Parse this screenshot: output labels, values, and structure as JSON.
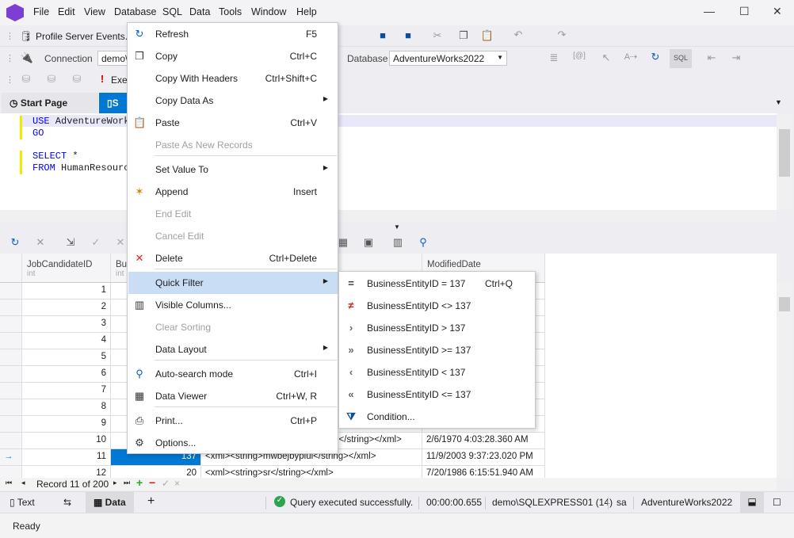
{
  "menubar": {
    "items": [
      "File",
      "Edit",
      "View",
      "Database",
      "SQL",
      "Data",
      "Tools",
      "Window",
      "Help"
    ]
  },
  "toolbar": {
    "profile_label": "Profile Server Events...",
    "connection_label": "Connection",
    "connection_value": "demo\\",
    "database_label": "Database",
    "database_value": "AdventureWorks2022",
    "execute_label": "Exe"
  },
  "tabs": {
    "start_page": "Start Page",
    "sql_tab": "S"
  },
  "editor": {
    "lines": [
      {
        "kw": "USE",
        "rest": " AdventureWork"
      },
      {
        "kw": "GO",
        "rest": ""
      },
      {
        "kw": "SELECT",
        "rest": " *"
      },
      {
        "kw": "FROM",
        "rest": " HumanResourc"
      }
    ]
  },
  "grid": {
    "columns": [
      {
        "name": "JobCandidateID",
        "type": "int"
      },
      {
        "name": "Bus",
        "type": "int"
      },
      {
        "name": "",
        "type": ""
      },
      {
        "name": "ModifiedDate",
        "type": ""
      }
    ],
    "rows": [
      {
        "id": "1"
      },
      {
        "id": "2"
      },
      {
        "id": "3"
      },
      {
        "id": "4"
      },
      {
        "id": "5"
      },
      {
        "id": "6"
      },
      {
        "id": "7"
      },
      {
        "id": "8"
      },
      {
        "id": "9"
      },
      {
        "id": "10",
        "bus": "",
        "resume": "l</string></xml>",
        "date": "2/6/1970 4:03:28.360 AM"
      },
      {
        "id": "11",
        "bus": "137",
        "resume": "<xml><string>mwbejbypiui</string></xml>",
        "date": "11/9/2003 9:37:23.020 PM",
        "current": true
      },
      {
        "id": "12",
        "bus": "20",
        "resume": "<xml><string>sr</string></xml>",
        "date": "7/20/1986 6:15:51.940 AM"
      }
    ]
  },
  "navigator": {
    "record": "Record 11 of 200"
  },
  "context_menu": {
    "items": [
      {
        "label": "Refresh",
        "shortcut": "F5",
        "icon": "refresh-icon"
      },
      {
        "label": "Copy",
        "shortcut": "Ctrl+C",
        "icon": "copy-icon"
      },
      {
        "label": "Copy With Headers",
        "shortcut": "Ctrl+Shift+C"
      },
      {
        "label": "Copy Data As",
        "submenu": true
      },
      {
        "label": "Paste",
        "shortcut": "Ctrl+V",
        "icon": "paste-icon"
      },
      {
        "label": "Paste As New Records",
        "disabled": true
      },
      {
        "label": "Set Value To",
        "submenu": true
      },
      {
        "label": "Append",
        "shortcut": "Insert",
        "icon": "append-icon"
      },
      {
        "label": "End Edit",
        "disabled": true
      },
      {
        "label": "Cancel Edit",
        "disabled": true
      },
      {
        "label": "Delete",
        "shortcut": "Ctrl+Delete",
        "icon": "delete-icon"
      },
      {
        "label": "Quick Filter",
        "submenu": true,
        "highlighted": true
      },
      {
        "label": "Visible Columns...",
        "icon": "columns-icon"
      },
      {
        "label": "Clear Sorting",
        "disabled": true
      },
      {
        "label": "Data Layout",
        "submenu": true
      },
      {
        "label": "Auto-search mode",
        "shortcut": "Ctrl+I",
        "icon": "auto-search-icon"
      },
      {
        "label": "Data Viewer",
        "shortcut": "Ctrl+W, R",
        "icon": "data-viewer-icon"
      },
      {
        "label": "Print...",
        "shortcut": "Ctrl+P",
        "icon": "print-icon"
      },
      {
        "label": "Options...",
        "icon": "gear-icon"
      }
    ]
  },
  "quick_filter": {
    "items": [
      {
        "label": "BusinessEntityID = 137",
        "shortcut": "Ctrl+Q",
        "icon": "equals-icon"
      },
      {
        "label": "BusinessEntityID <> 137",
        "icon": "not-equals-icon"
      },
      {
        "label": "BusinessEntityID > 137",
        "icon": "greater-icon"
      },
      {
        "label": "BusinessEntityID >= 137",
        "icon": "greater-equal-icon"
      },
      {
        "label": "BusinessEntityID < 137",
        "icon": "less-icon"
      },
      {
        "label": "BusinessEntityID <= 137",
        "icon": "less-equal-icon"
      },
      {
        "label": "Condition...",
        "icon": "filter-icon"
      }
    ]
  },
  "bottom": {
    "text_tab": "Text",
    "data_tab": "Data",
    "status": "Query executed successfully.",
    "elapsed": "00:00:00.655",
    "server": "demo\\SQLEXPRESS01 (14)",
    "user": "sa",
    "database": "AdventureWorks2022"
  },
  "statusbar": {
    "text": "Ready"
  },
  "colors": {
    "accent": "#0078d4",
    "menu_highlight": "#c9ddf4",
    "success": "#2da44e"
  }
}
